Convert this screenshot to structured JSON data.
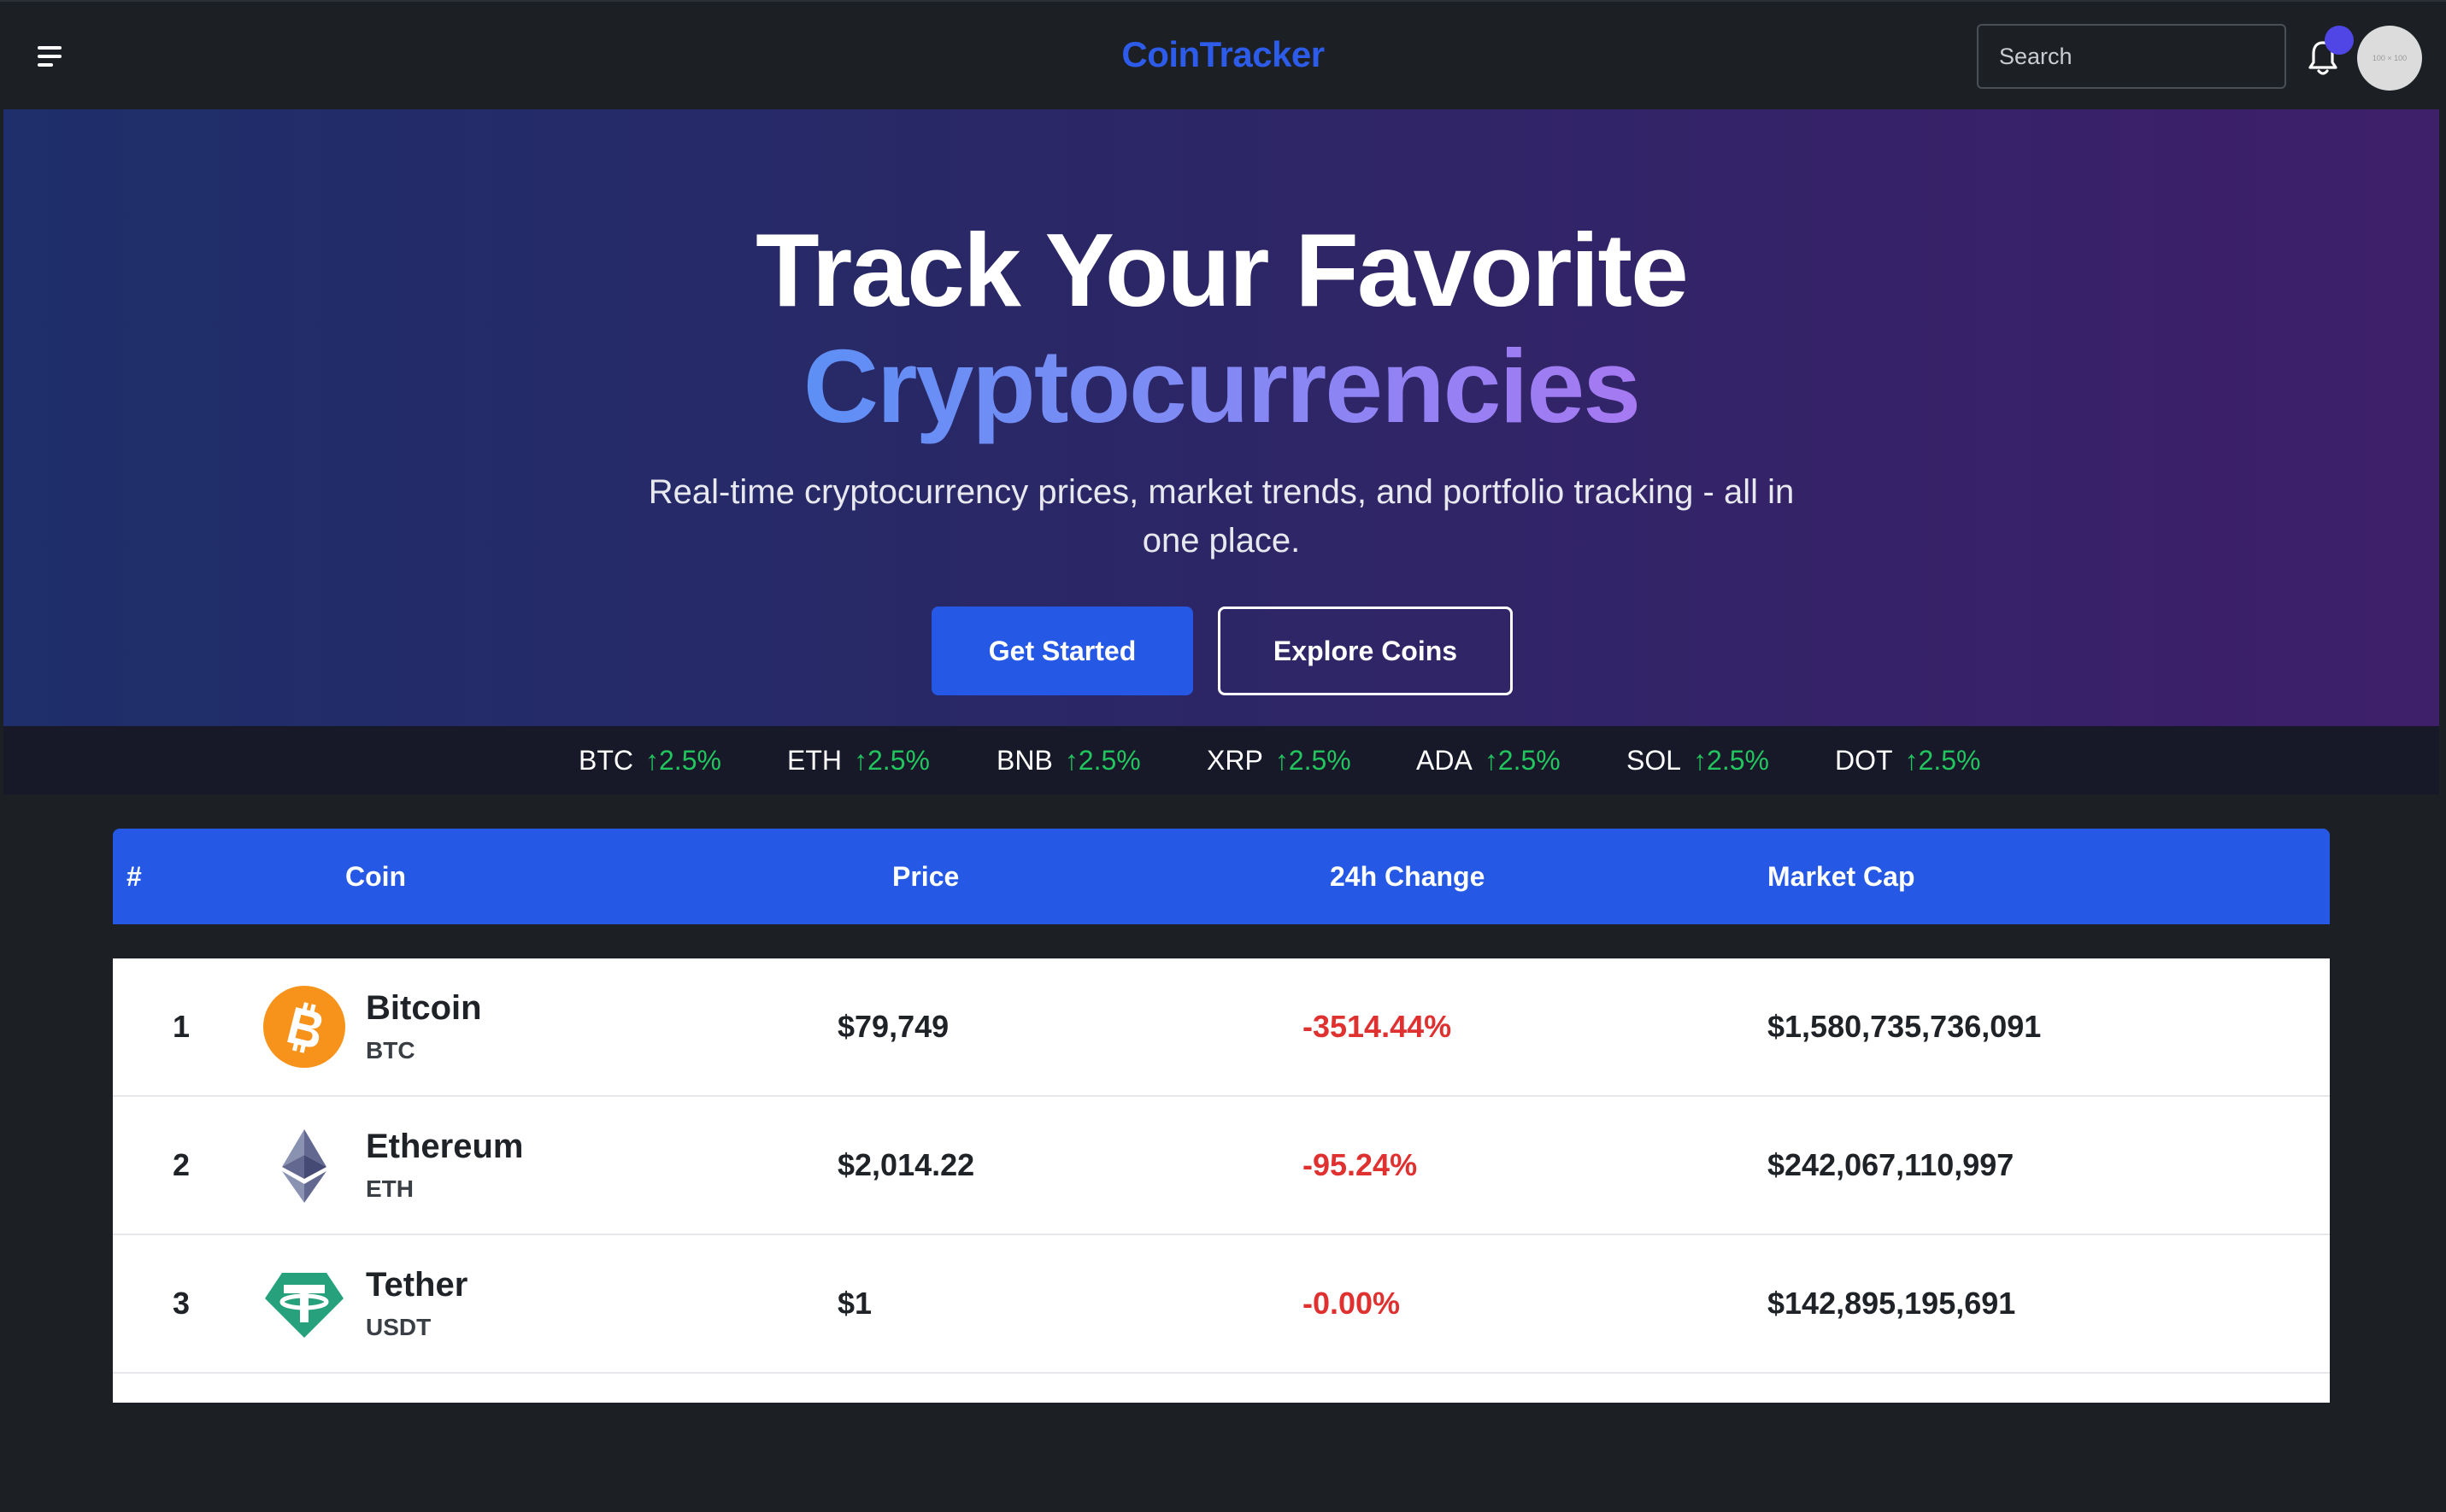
{
  "nav": {
    "logo": "CoinTracker",
    "search_placeholder": "Search",
    "avatar_text": "100 × 100"
  },
  "hero": {
    "title_line1": "Track Your Favorite",
    "title_line2": "Cryptocurrencies",
    "subtitle": "Real-time cryptocurrency prices, market trends, and portfolio tracking - all in one place.",
    "primary_button": "Get Started",
    "secondary_button": "Explore Coins"
  },
  "ticker": [
    {
      "symbol": "BTC",
      "change": "↑2.5%"
    },
    {
      "symbol": "ETH",
      "change": "↑2.5%"
    },
    {
      "symbol": "BNB",
      "change": "↑2.5%"
    },
    {
      "symbol": "XRP",
      "change": "↑2.5%"
    },
    {
      "symbol": "ADA",
      "change": "↑2.5%"
    },
    {
      "symbol": "SOL",
      "change": "↑2.5%"
    },
    {
      "symbol": "DOT",
      "change": "↑2.5%"
    }
  ],
  "table": {
    "headers": [
      "#",
      "Coin",
      "Price",
      "24h Change",
      "Market Cap"
    ],
    "rows": [
      {
        "rank": "1",
        "name": "Bitcoin",
        "symbol": "BTC",
        "price": "$79,749",
        "change": "-3514.44%",
        "market_cap": "$1,580,735,736,091",
        "icon": "bitcoin-icon"
      },
      {
        "rank": "2",
        "name": "Ethereum",
        "symbol": "ETH",
        "price": "$2,014.22",
        "change": "-95.24%",
        "market_cap": "$242,067,110,997",
        "icon": "ethereum-icon"
      },
      {
        "rank": "3",
        "name": "Tether",
        "symbol": "USDT",
        "price": "$1",
        "change": "-0.00%",
        "market_cap": "$142,895,195,691",
        "icon": "tether-icon"
      }
    ]
  },
  "colors": {
    "brand": "#2d5bea",
    "primary_button": "#2458e5",
    "positive": "#22c55e",
    "negative": "#e03131",
    "notification_dot": "#4f46e5"
  }
}
